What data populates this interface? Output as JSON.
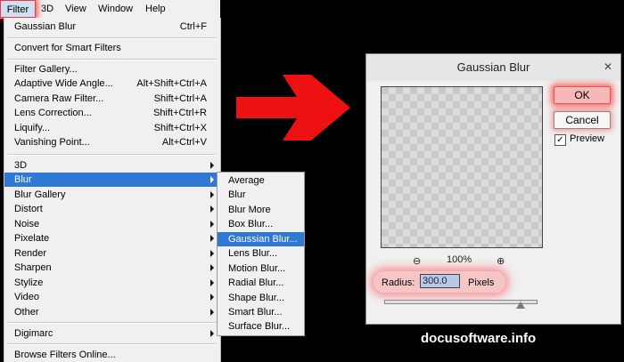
{
  "menubar": {
    "items": [
      "Filter",
      "3D",
      "View",
      "Window",
      "Help"
    ]
  },
  "filter_menu": {
    "last_filter": {
      "label": "Gaussian Blur",
      "shortcut": "Ctrl+F"
    },
    "convert": {
      "label": "Convert for Smart Filters"
    },
    "gallery_items": [
      {
        "label": "Filter Gallery...",
        "shortcut": ""
      },
      {
        "label": "Adaptive Wide Angle...",
        "shortcut": "Alt+Shift+Ctrl+A"
      },
      {
        "label": "Camera Raw Filter...",
        "shortcut": "Shift+Ctrl+A"
      },
      {
        "label": "Lens Correction...",
        "shortcut": "Shift+Ctrl+R"
      },
      {
        "label": "Liquify...",
        "shortcut": "Shift+Ctrl+X"
      },
      {
        "label": "Vanishing Point...",
        "shortcut": "Alt+Ctrl+V"
      }
    ],
    "submenus": [
      "3D",
      "Blur",
      "Blur Gallery",
      "Distort",
      "Noise",
      "Pixelate",
      "Render",
      "Sharpen",
      "Stylize",
      "Video",
      "Other"
    ],
    "digimarc": "Digimarc",
    "browse": "Browse Filters Online..."
  },
  "blur_submenu": {
    "items": [
      "Average",
      "Blur",
      "Blur More",
      "Box Blur...",
      "Gaussian Blur...",
      "Lens Blur...",
      "Motion Blur...",
      "Radial Blur...",
      "Shape Blur...",
      "Smart Blur...",
      "Surface Blur..."
    ],
    "highlighted_index": 4
  },
  "arrow": {
    "color": "#ee1111"
  },
  "dialog": {
    "title": "Gaussian Blur",
    "close_glyph": "✕",
    "ok_label": "OK",
    "cancel_label": "Cancel",
    "preview_label": "Preview",
    "preview_checked": true,
    "zoom_out_glyph": "⊖",
    "zoom_in_glyph": "⊕",
    "zoom_level": "100%",
    "radius_label": "Radius:",
    "radius_value": "300.0",
    "radius_unit": "Pixels",
    "slider_fraction": 0.9
  },
  "watermark": "docusoftware.info"
}
